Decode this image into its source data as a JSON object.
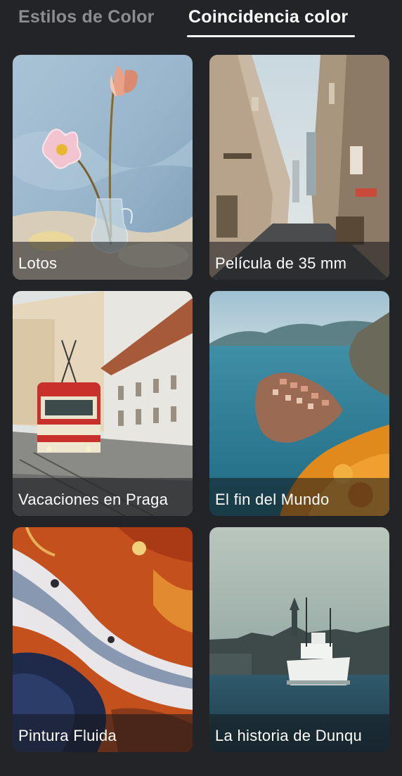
{
  "tabs": {
    "styles_label": "Estilos de Color",
    "match_label": "Coincidencia color",
    "active": "Coincidencia color"
  },
  "cards": [
    {
      "title": "Lotos"
    },
    {
      "title": "Película de 35 mm"
    },
    {
      "title": "Vacaciones en Praga"
    },
    {
      "title": "El fin del Mundo"
    },
    {
      "title": "Pintura Fluida"
    },
    {
      "title": "La historia de Dunqu"
    }
  ],
  "colors": {
    "background": "#222427",
    "tab_active": "#ffffff",
    "tab_inactive": "#8b8d91"
  }
}
